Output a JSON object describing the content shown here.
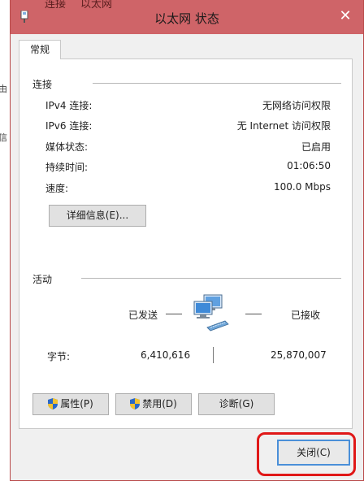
{
  "background": {
    "fragment_1": "由",
    "fragment_2": "信",
    "title_fragment_1": "连接",
    "title_fragment_2": "以太网"
  },
  "window": {
    "title": "以太网 状态",
    "accent_color": "#cf6468"
  },
  "tabs": [
    {
      "label": "常规"
    }
  ],
  "connection": {
    "section_label": "连接",
    "rows": [
      {
        "label": "IPv4 连接:",
        "value": "无网络访问权限"
      },
      {
        "label": "IPv6 连接:",
        "value": "无 Internet 访问权限"
      },
      {
        "label": "媒体状态:",
        "value": "已启用"
      },
      {
        "label": "持续时间:",
        "value": "01:06:50"
      },
      {
        "label": "速度:",
        "value": "100.0 Mbps"
      }
    ],
    "details_button": "详细信息(E)..."
  },
  "activity": {
    "section_label": "活动",
    "sent_label": "已发送",
    "received_label": "已接收",
    "bytes_label": "字节:",
    "bytes_sent": "6,410,616",
    "bytes_received": "25,870,007"
  },
  "buttons": {
    "properties": "属性(P)",
    "disable": "禁用(D)",
    "diagnose": "诊断(G)",
    "close": "关闭(C)"
  },
  "icons": {
    "app": "network-adapter-icon",
    "network": "network-computers-icon",
    "shield": "uac-shield-icon"
  }
}
